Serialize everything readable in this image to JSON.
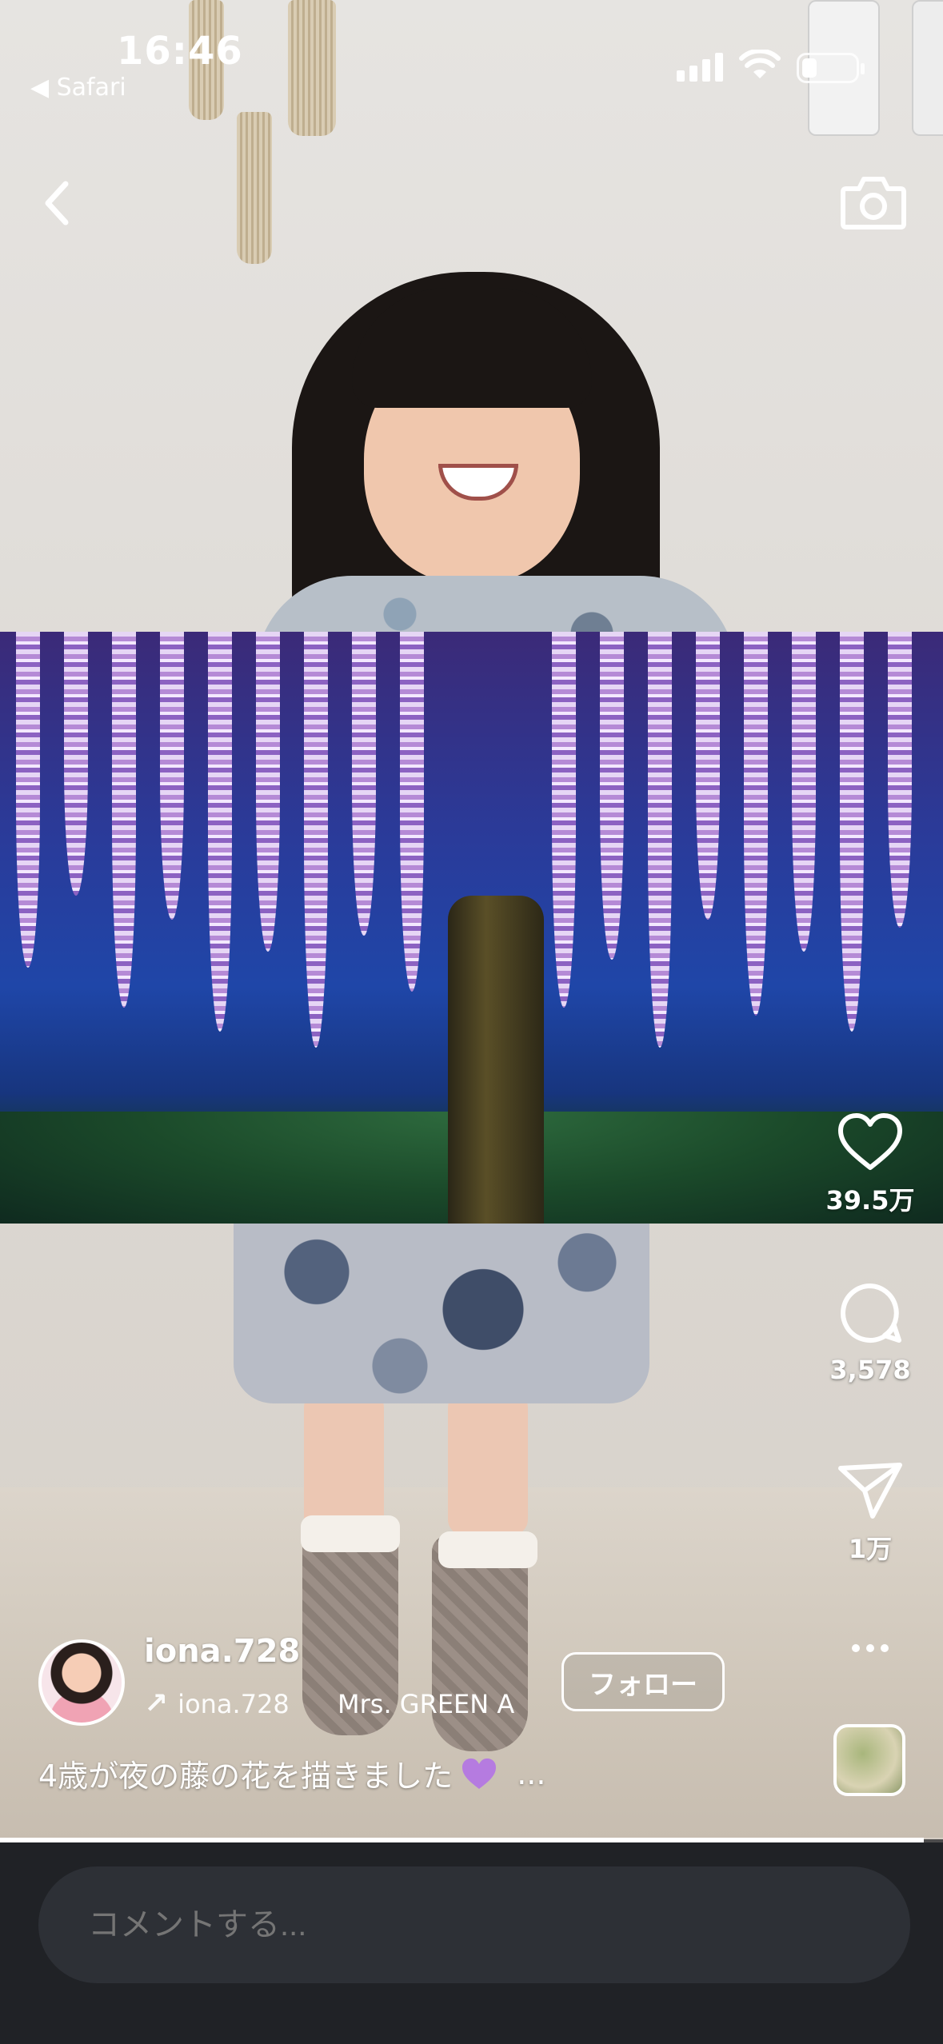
{
  "status_bar": {
    "time": "16:46",
    "back_app": "◀ Safari"
  },
  "actions": {
    "likes": "39.5万",
    "comments": "3,578",
    "shares": "1万"
  },
  "post": {
    "username": "iona.728",
    "repost_user": "iona.728",
    "audio": "Mrs. GREEN A",
    "follow_label": "フォロー",
    "caption": "4歳が夜の藤の花を描きました",
    "caption_more": "..."
  },
  "progress": 0.98,
  "comment_box": {
    "placeholder": "コメントする..."
  },
  "icons": {
    "back": "chevron-left-icon",
    "camera": "camera-icon",
    "like": "heart-icon",
    "comment": "comment-bubble-icon",
    "share": "paper-plane-icon",
    "more": "more-dots-icon"
  },
  "colors": {
    "heart_emoji": "#b57be0",
    "bottom_bar": "#202226"
  }
}
